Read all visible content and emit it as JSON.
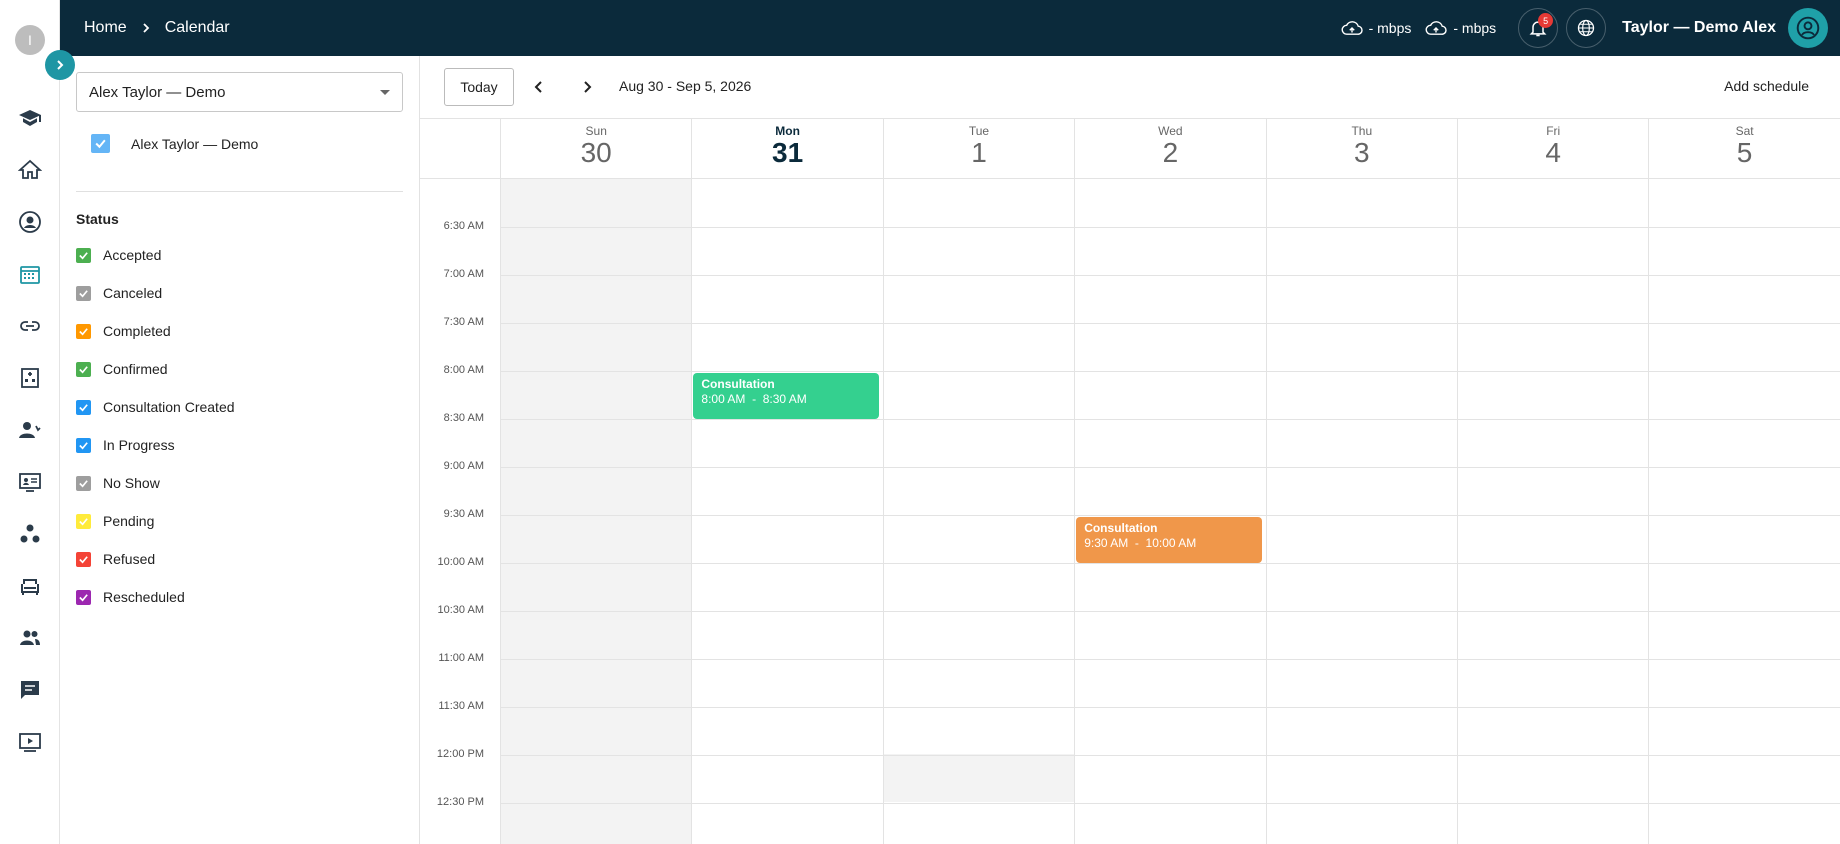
{
  "header": {
    "breadcrumb_home": "Home",
    "breadcrumb_current": "Calendar",
    "upload_speed": "- mbps",
    "download_speed": "- mbps",
    "notification_count": "5",
    "user_name": "Taylor — Demo Alex"
  },
  "rail": {
    "logo_letter": "I",
    "items": [
      "graduation-cap-icon",
      "home-icon",
      "provider-icon",
      "calendar-icon",
      "link-icon",
      "clinic-icon",
      "patient-icon",
      "telehealth-icon",
      "group-icon",
      "waiting-room-icon",
      "users-icon",
      "chat-icon",
      "video-icon"
    ]
  },
  "filters": {
    "calendar_select_value": "Alex Taylor — Demo",
    "calendar_check_label": "Alex Taylor — Demo",
    "status_title": "Status",
    "statuses": [
      {
        "label": "Accepted",
        "color": "#4caf50"
      },
      {
        "label": "Canceled",
        "color": "#9e9e9e"
      },
      {
        "label": "Completed",
        "color": "#ff9800"
      },
      {
        "label": "Confirmed",
        "color": "#4caf50"
      },
      {
        "label": "Consultation Created",
        "color": "#2196f3"
      },
      {
        "label": "In Progress",
        "color": "#2196f3"
      },
      {
        "label": "No Show",
        "color": "#9e9e9e"
      },
      {
        "label": "Pending",
        "color": "#ffeb3b"
      },
      {
        "label": "Refused",
        "color": "#f44336"
      },
      {
        "label": "Rescheduled",
        "color": "#9c27b0"
      }
    ]
  },
  "calendar": {
    "today_label": "Today",
    "date_range": "Aug 30 - Sep 5, 2026",
    "add_schedule_label": "Add schedule",
    "days": [
      {
        "name": "Sun",
        "num": "30"
      },
      {
        "name": "Mon",
        "num": "31"
      },
      {
        "name": "Tue",
        "num": "1"
      },
      {
        "name": "Wed",
        "num": "2"
      },
      {
        "name": "Thu",
        "num": "3"
      },
      {
        "name": "Fri",
        "num": "4"
      },
      {
        "name": "Sat",
        "num": "5"
      }
    ],
    "today_index": 1,
    "times": [
      "6:30 AM",
      "7:00 AM",
      "7:30 AM",
      "8:00 AM",
      "8:30 AM",
      "9:00 AM",
      "9:30 AM",
      "10:00 AM",
      "10:30 AM",
      "11:00 AM",
      "11:30 AM",
      "12:00 PM",
      "12:30 PM"
    ],
    "events": [
      {
        "title": "Consultation",
        "time": "8:00 AM  -  8:30 AM",
        "day": "Mon",
        "color": "#34d08f"
      },
      {
        "title": "Consultation",
        "time": "9:30 AM  -  10:00 AM",
        "day": "Wed",
        "color": "#f0974a"
      }
    ]
  },
  "colors": {
    "topbar": "#0b2a3b",
    "accent": "#1e96a4"
  }
}
